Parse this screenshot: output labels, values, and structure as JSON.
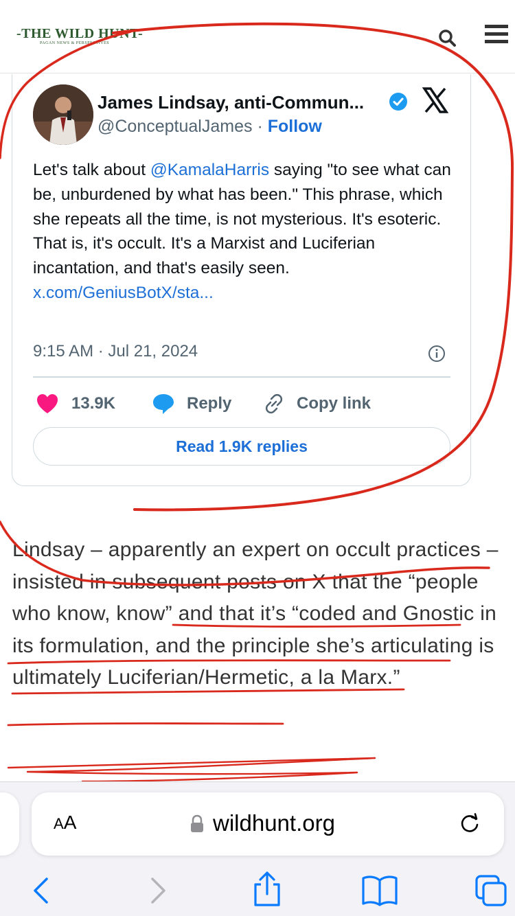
{
  "site": {
    "logo_main": "-THE WILD HUNT-",
    "logo_sub": "PAGAN NEWS & PERSPECTIVES",
    "brand_color": "#2e5a2f"
  },
  "header": {
    "search_icon": "search-icon",
    "menu_icon": "hamburger-menu-icon"
  },
  "tweet": {
    "author_name": "James Lindsay, anti-Commun...",
    "handle": "@ConceptualJames",
    "separator": " · ",
    "follow_label": "Follow",
    "text_before": "Let's talk about ",
    "mention": "@KamalaHarris",
    "text_after": " saying \"to see what can be, unburdened by what has been.\" This phrase, which she repeats all the time, is not mysterious. It's esoteric. That is, it's occult. It's a Marxist and Luciferian incantation, and that's easily seen.",
    "link": "x.com/GeniusBotX/sta...",
    "timestamp": "9:15 AM · Jul 21, 2024",
    "likes": "13.9K",
    "reply_label": "Reply",
    "copy_link_label": "Copy link",
    "read_replies_label": "Read 1.9K replies",
    "link_color": "#1d6fd8",
    "like_color": "#f91880"
  },
  "article": {
    "paragraph": "Lindsay – apparently an expert on occult practices – insisted in subsequent posts on X that the “people who know, know” and that it’s “coded and Gnostic in its formulation, and the principle she’s articulating is ultimately Luciferian/Hermetic, a la Marx.”"
  },
  "annotation": {
    "ink_color": "#d9281c"
  },
  "browser": {
    "text_size_label_small": "A",
    "text_size_label_large": "A",
    "url": "wildhunt.org",
    "accent_color": "#0a7aff"
  }
}
